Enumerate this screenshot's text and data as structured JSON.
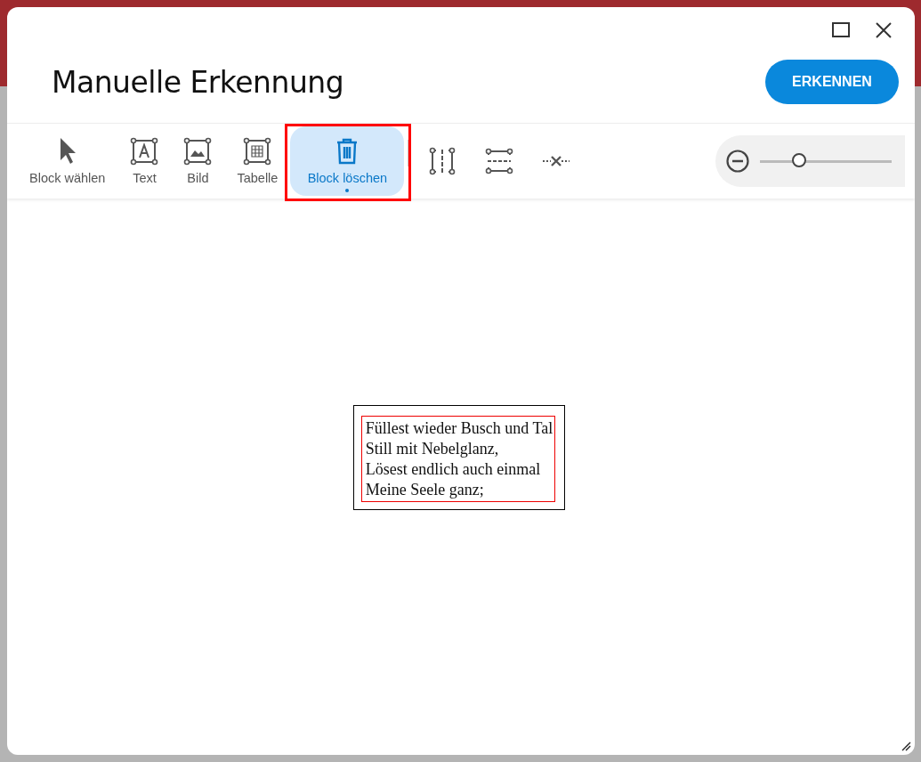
{
  "dialog": {
    "title": "Manuelle Erkennung",
    "primary_button": "ERKENNEN"
  },
  "tools": [
    {
      "kind": "select",
      "label": "Block wählen",
      "selected": false,
      "highlighted": false
    },
    {
      "kind": "text",
      "label": "Text",
      "selected": false,
      "highlighted": false
    },
    {
      "kind": "image",
      "label": "Bild",
      "selected": false,
      "highlighted": false
    },
    {
      "kind": "table",
      "label": "Tabelle",
      "selected": false,
      "highlighted": false
    },
    {
      "kind": "delete",
      "label": "Block löschen",
      "selected": true,
      "highlighted": true
    },
    {
      "kind": "split-vertical",
      "selected": false,
      "highlighted": false
    },
    {
      "kind": "split-horizontal",
      "selected": false,
      "highlighted": false
    },
    {
      "kind": "remove-separator",
      "selected": false,
      "highlighted": false
    }
  ],
  "zoom": {
    "level": 0.3
  },
  "text_block": {
    "selected": true,
    "lines": [
      "Füllest wieder Busch und Tal",
      "Still mit Nebelglanz,",
      "Lösest endlich auch einmal",
      "Meine Seele ganz;"
    ]
  }
}
